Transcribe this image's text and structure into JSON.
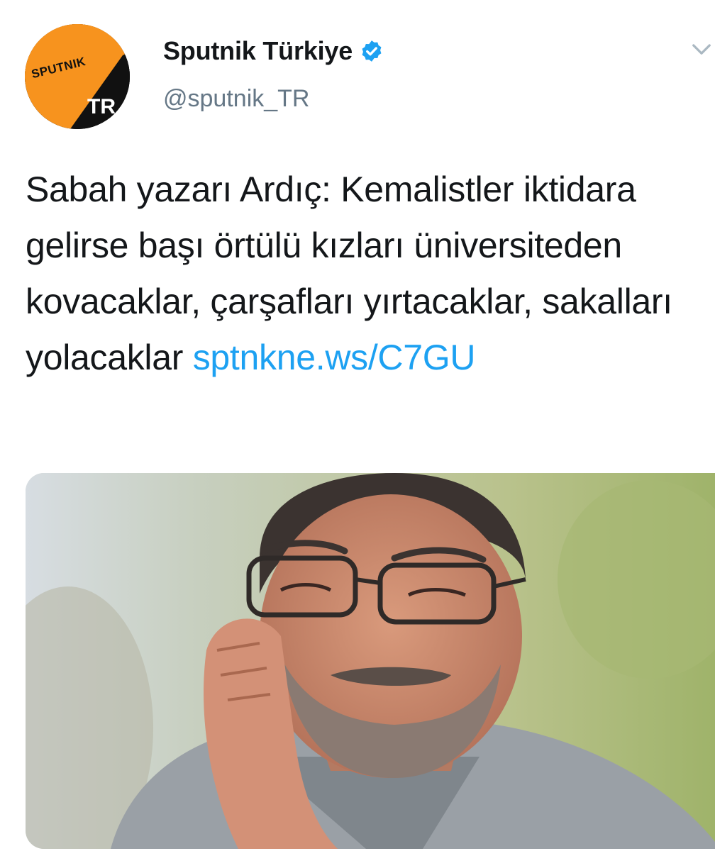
{
  "account": {
    "display_name": "Sputnik Türkiye",
    "handle": "@sputnik_TR",
    "avatar_logo_text": "SPUTNIK",
    "avatar_badge_text": "TR"
  },
  "tweet": {
    "text": "Sabah yazarı Ardıç: Kemalistler iktidara gelirse başı örtülü kızları üniversiteden kovacaklar, çarşafları yırtacaklar, sakalları yolacaklar",
    "link_text": "sptnkne.ws/C7GU"
  },
  "icons": {
    "verified": "verified-badge-icon",
    "menu": "chevron-down-icon"
  },
  "colors": {
    "link": "#1da1f2",
    "verified": "#1da1f2",
    "brand_orange": "#f7931e",
    "secondary_text": "#657786"
  }
}
